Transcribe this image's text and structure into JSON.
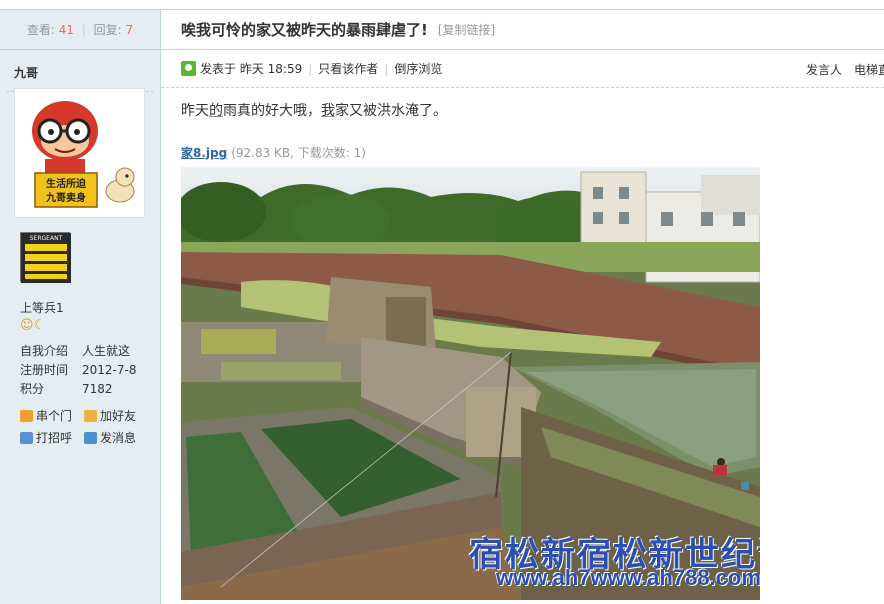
{
  "stats": {
    "views_label": "查看:",
    "views": "41",
    "replies_label": "回复:",
    "replies": "7"
  },
  "author": {
    "name": "九哥",
    "rank": "上等兵1",
    "medal_icons": [
      "smile-icon",
      "moon-icon"
    ]
  },
  "avatar": {
    "line1": "生活所迫",
    "line2": "九哥卖身"
  },
  "badge": {
    "label": "SERGEANT"
  },
  "profile": [
    {
      "key": "自我介绍",
      "value": "人生就这"
    },
    {
      "key": "注册时间",
      "value": "2012-7-8"
    },
    {
      "key": "积分",
      "value": "7182"
    }
  ],
  "actions": [
    {
      "label": "串个门",
      "icon": "home-icon",
      "color": "#f0a030"
    },
    {
      "label": "加好友",
      "icon": "handshake-icon",
      "color": "#f0b040"
    },
    {
      "label": "打招呼",
      "icon": "greet-icon",
      "color": "#5a8fd6"
    },
    {
      "label": "发消息",
      "icon": "mail-icon",
      "color": "#4a90d0"
    }
  ],
  "thread": {
    "title": "唉我可怜的家又被昨天的暴雨肆虐了!",
    "copy_link": "[复制链接]"
  },
  "meta": {
    "posted": "发表于 昨天 18:59",
    "only_author": "只看该作者",
    "reverse": "倒序浏览",
    "speaker": "发言人",
    "elevator": "电梯直"
  },
  "post": {
    "text_a": "昨天",
    "text_b": "的",
    "text_c": "雨真的好大哦，",
    "text_d": "我",
    "text_e": "家又被洪水淹了。"
  },
  "attachment": {
    "filename": "家8.jpg",
    "info": "(92.83 KB, 下载次数: 1)"
  },
  "watermark": {
    "text": "宿松新宿松新世纪论坛",
    "url": "www.ah7www.ah788.com"
  },
  "colors": {
    "sidebar_bg": "#e5edf2",
    "link": "#336699",
    "count": "#f26c4f",
    "watermark": "#2b4fb0"
  }
}
